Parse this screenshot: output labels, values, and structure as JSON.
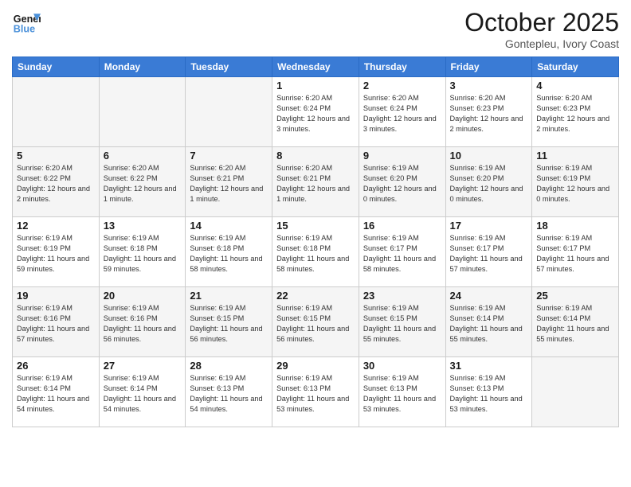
{
  "header": {
    "logo_line1": "General",
    "logo_line2": "Blue",
    "month": "October 2025",
    "location": "Gontepleu, Ivory Coast"
  },
  "weekdays": [
    "Sunday",
    "Monday",
    "Tuesday",
    "Wednesday",
    "Thursday",
    "Friday",
    "Saturday"
  ],
  "weeks": [
    [
      {
        "day": "",
        "info": ""
      },
      {
        "day": "",
        "info": ""
      },
      {
        "day": "",
        "info": ""
      },
      {
        "day": "1",
        "info": "Sunrise: 6:20 AM\nSunset: 6:24 PM\nDaylight: 12 hours and 3 minutes."
      },
      {
        "day": "2",
        "info": "Sunrise: 6:20 AM\nSunset: 6:24 PM\nDaylight: 12 hours and 3 minutes."
      },
      {
        "day": "3",
        "info": "Sunrise: 6:20 AM\nSunset: 6:23 PM\nDaylight: 12 hours and 2 minutes."
      },
      {
        "day": "4",
        "info": "Sunrise: 6:20 AM\nSunset: 6:23 PM\nDaylight: 12 hours and 2 minutes."
      }
    ],
    [
      {
        "day": "5",
        "info": "Sunrise: 6:20 AM\nSunset: 6:22 PM\nDaylight: 12 hours and 2 minutes."
      },
      {
        "day": "6",
        "info": "Sunrise: 6:20 AM\nSunset: 6:22 PM\nDaylight: 12 hours and 1 minute."
      },
      {
        "day": "7",
        "info": "Sunrise: 6:20 AM\nSunset: 6:21 PM\nDaylight: 12 hours and 1 minute."
      },
      {
        "day": "8",
        "info": "Sunrise: 6:20 AM\nSunset: 6:21 PM\nDaylight: 12 hours and 1 minute."
      },
      {
        "day": "9",
        "info": "Sunrise: 6:19 AM\nSunset: 6:20 PM\nDaylight: 12 hours and 0 minutes."
      },
      {
        "day": "10",
        "info": "Sunrise: 6:19 AM\nSunset: 6:20 PM\nDaylight: 12 hours and 0 minutes."
      },
      {
        "day": "11",
        "info": "Sunrise: 6:19 AM\nSunset: 6:19 PM\nDaylight: 12 hours and 0 minutes."
      }
    ],
    [
      {
        "day": "12",
        "info": "Sunrise: 6:19 AM\nSunset: 6:19 PM\nDaylight: 11 hours and 59 minutes."
      },
      {
        "day": "13",
        "info": "Sunrise: 6:19 AM\nSunset: 6:18 PM\nDaylight: 11 hours and 59 minutes."
      },
      {
        "day": "14",
        "info": "Sunrise: 6:19 AM\nSunset: 6:18 PM\nDaylight: 11 hours and 58 minutes."
      },
      {
        "day": "15",
        "info": "Sunrise: 6:19 AM\nSunset: 6:18 PM\nDaylight: 11 hours and 58 minutes."
      },
      {
        "day": "16",
        "info": "Sunrise: 6:19 AM\nSunset: 6:17 PM\nDaylight: 11 hours and 58 minutes."
      },
      {
        "day": "17",
        "info": "Sunrise: 6:19 AM\nSunset: 6:17 PM\nDaylight: 11 hours and 57 minutes."
      },
      {
        "day": "18",
        "info": "Sunrise: 6:19 AM\nSunset: 6:17 PM\nDaylight: 11 hours and 57 minutes."
      }
    ],
    [
      {
        "day": "19",
        "info": "Sunrise: 6:19 AM\nSunset: 6:16 PM\nDaylight: 11 hours and 57 minutes."
      },
      {
        "day": "20",
        "info": "Sunrise: 6:19 AM\nSunset: 6:16 PM\nDaylight: 11 hours and 56 minutes."
      },
      {
        "day": "21",
        "info": "Sunrise: 6:19 AM\nSunset: 6:15 PM\nDaylight: 11 hours and 56 minutes."
      },
      {
        "day": "22",
        "info": "Sunrise: 6:19 AM\nSunset: 6:15 PM\nDaylight: 11 hours and 56 minutes."
      },
      {
        "day": "23",
        "info": "Sunrise: 6:19 AM\nSunset: 6:15 PM\nDaylight: 11 hours and 55 minutes."
      },
      {
        "day": "24",
        "info": "Sunrise: 6:19 AM\nSunset: 6:14 PM\nDaylight: 11 hours and 55 minutes."
      },
      {
        "day": "25",
        "info": "Sunrise: 6:19 AM\nSunset: 6:14 PM\nDaylight: 11 hours and 55 minutes."
      }
    ],
    [
      {
        "day": "26",
        "info": "Sunrise: 6:19 AM\nSunset: 6:14 PM\nDaylight: 11 hours and 54 minutes."
      },
      {
        "day": "27",
        "info": "Sunrise: 6:19 AM\nSunset: 6:14 PM\nDaylight: 11 hours and 54 minutes."
      },
      {
        "day": "28",
        "info": "Sunrise: 6:19 AM\nSunset: 6:13 PM\nDaylight: 11 hours and 54 minutes."
      },
      {
        "day": "29",
        "info": "Sunrise: 6:19 AM\nSunset: 6:13 PM\nDaylight: 11 hours and 53 minutes."
      },
      {
        "day": "30",
        "info": "Sunrise: 6:19 AM\nSunset: 6:13 PM\nDaylight: 11 hours and 53 minutes."
      },
      {
        "day": "31",
        "info": "Sunrise: 6:19 AM\nSunset: 6:13 PM\nDaylight: 11 hours and 53 minutes."
      },
      {
        "day": "",
        "info": ""
      }
    ]
  ]
}
